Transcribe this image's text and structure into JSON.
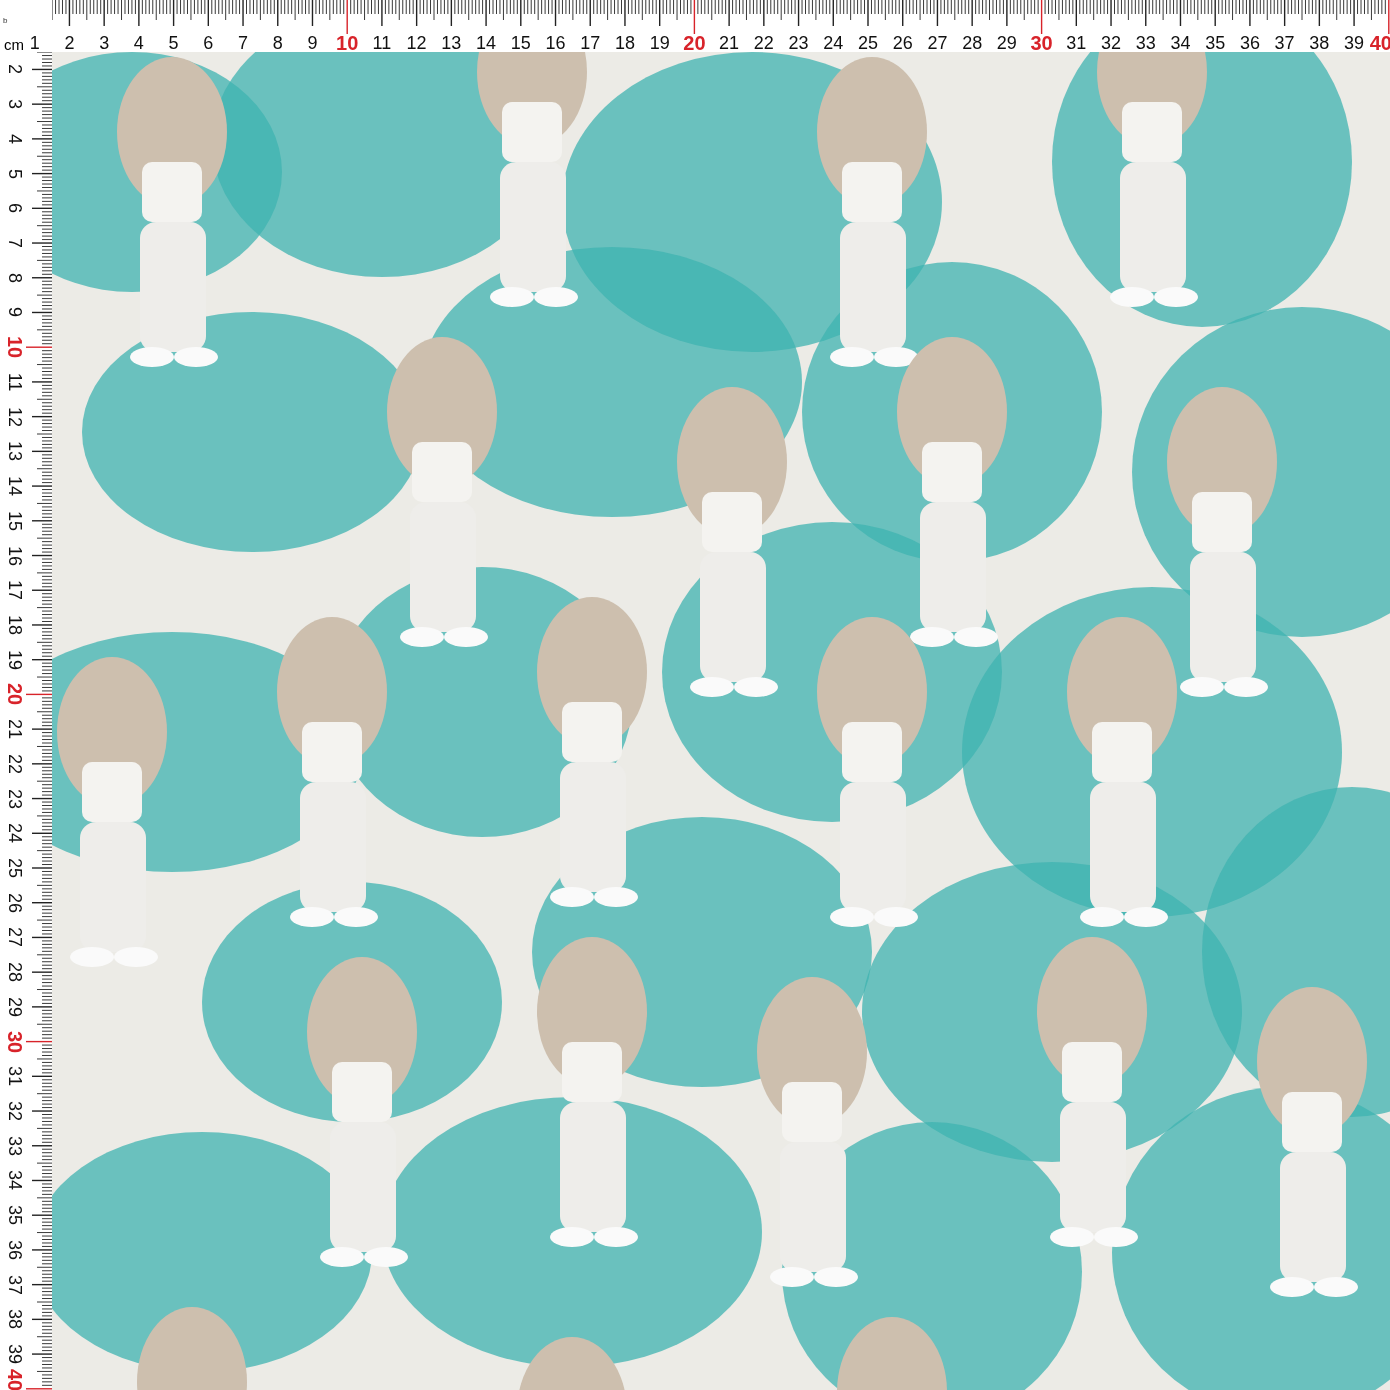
{
  "ruler_top": {
    "corner_mark": "b",
    "unit": "cm",
    "labels": [
      {
        "label": "1",
        "color": "#111111"
      },
      {
        "label": "2",
        "color": "#111111"
      },
      {
        "label": "3",
        "color": "#111111"
      },
      {
        "label": "4",
        "color": "#111111"
      },
      {
        "label": "5",
        "color": "#111111"
      },
      {
        "label": "6",
        "color": "#111111"
      },
      {
        "label": "7",
        "color": "#111111"
      },
      {
        "label": "8",
        "color": "#111111"
      },
      {
        "label": "9",
        "color": "#111111"
      },
      {
        "label": "10",
        "color": "#d8232a"
      },
      {
        "label": "11",
        "color": "#111111"
      },
      {
        "label": "12",
        "color": "#111111"
      },
      {
        "label": "13",
        "color": "#111111"
      },
      {
        "label": "14",
        "color": "#111111"
      },
      {
        "label": "15",
        "color": "#111111"
      },
      {
        "label": "16",
        "color": "#111111"
      },
      {
        "label": "17",
        "color": "#111111"
      },
      {
        "label": "18",
        "color": "#111111"
      },
      {
        "label": "19",
        "color": "#111111"
      },
      {
        "label": "20",
        "color": "#d8232a"
      },
      {
        "label": "21",
        "color": "#111111"
      },
      {
        "label": "22",
        "color": "#111111"
      },
      {
        "label": "23",
        "color": "#111111"
      },
      {
        "label": "24",
        "color": "#111111"
      },
      {
        "label": "25",
        "color": "#111111"
      },
      {
        "label": "26",
        "color": "#111111"
      },
      {
        "label": "27",
        "color": "#111111"
      },
      {
        "label": "28",
        "color": "#111111"
      },
      {
        "label": "29",
        "color": "#111111"
      },
      {
        "label": "30",
        "color": "#d8232a"
      },
      {
        "label": "31",
        "color": "#111111"
      },
      {
        "label": "32",
        "color": "#111111"
      },
      {
        "label": "33",
        "color": "#111111"
      },
      {
        "label": "34",
        "color": "#111111"
      },
      {
        "label": "35",
        "color": "#111111"
      },
      {
        "label": "36",
        "color": "#111111"
      },
      {
        "label": "37",
        "color": "#111111"
      },
      {
        "label": "38",
        "color": "#111111"
      },
      {
        "label": "39",
        "color": "#111111"
      },
      {
        "label": "40",
        "color": "#d8232a"
      }
    ]
  },
  "ruler_left": {
    "labels": [
      {
        "label": "2",
        "color": "#111111"
      },
      {
        "label": "3",
        "color": "#111111"
      },
      {
        "label": "4",
        "color": "#111111"
      },
      {
        "label": "5",
        "color": "#111111"
      },
      {
        "label": "6",
        "color": "#111111"
      },
      {
        "label": "7",
        "color": "#111111"
      },
      {
        "label": "8",
        "color": "#111111"
      },
      {
        "label": "9",
        "color": "#111111"
      },
      {
        "label": "10",
        "color": "#d8232a"
      },
      {
        "label": "11",
        "color": "#111111"
      },
      {
        "label": "12",
        "color": "#111111"
      },
      {
        "label": "13",
        "color": "#111111"
      },
      {
        "label": "14",
        "color": "#111111"
      },
      {
        "label": "15",
        "color": "#111111"
      },
      {
        "label": "16",
        "color": "#111111"
      },
      {
        "label": "17",
        "color": "#111111"
      },
      {
        "label": "18",
        "color": "#111111"
      },
      {
        "label": "19",
        "color": "#111111"
      },
      {
        "label": "20",
        "color": "#d8232a"
      },
      {
        "label": "21",
        "color": "#111111"
      },
      {
        "label": "22",
        "color": "#111111"
      },
      {
        "label": "23",
        "color": "#111111"
      },
      {
        "label": "24",
        "color": "#111111"
      },
      {
        "label": "25",
        "color": "#111111"
      },
      {
        "label": "26",
        "color": "#111111"
      },
      {
        "label": "27",
        "color": "#111111"
      },
      {
        "label": "28",
        "color": "#111111"
      },
      {
        "label": "29",
        "color": "#111111"
      },
      {
        "label": "30",
        "color": "#d8232a"
      },
      {
        "label": "31",
        "color": "#111111"
      },
      {
        "label": "32",
        "color": "#111111"
      },
      {
        "label": "33",
        "color": "#111111"
      },
      {
        "label": "34",
        "color": "#111111"
      },
      {
        "label": "35",
        "color": "#111111"
      },
      {
        "label": "36",
        "color": "#111111"
      },
      {
        "label": "37",
        "color": "#111111"
      },
      {
        "label": "38",
        "color": "#111111"
      },
      {
        "label": "39",
        "color": "#111111"
      },
      {
        "label": "40",
        "color": "#d8232a"
      }
    ]
  }
}
